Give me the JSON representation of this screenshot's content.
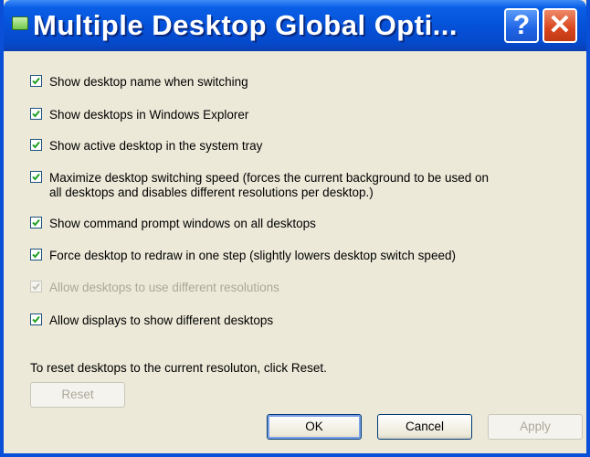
{
  "window": {
    "title": "Multiple Desktop Global Opti...",
    "help_symbol": "?",
    "close_symbol": "✕"
  },
  "options": [
    {
      "label": "Show desktop name when switching",
      "checked": true,
      "enabled": true
    },
    {
      "label": "Show desktops in Windows Explorer",
      "checked": true,
      "enabled": true
    },
    {
      "label": "Show active desktop in the system tray",
      "checked": true,
      "enabled": true
    },
    {
      "label": "Maximize desktop switching speed (forces the current background to be used on\nall desktops and disables different resolutions per desktop.)",
      "checked": true,
      "enabled": true
    },
    {
      "label": "Show command prompt windows on all desktops",
      "checked": true,
      "enabled": true
    },
    {
      "label": "Force desktop to redraw in one step (slightly lowers desktop switch speed)",
      "checked": true,
      "enabled": true
    },
    {
      "label": "Allow desktops to use different resolutions",
      "checked": true,
      "enabled": false
    },
    {
      "label": "Allow displays to show different desktops",
      "checked": true,
      "enabled": true
    }
  ],
  "reset_hint": "To reset desktops to the current resoluton, click Reset.",
  "buttons": {
    "reset": "Reset",
    "ok": "OK",
    "cancel": "Cancel",
    "apply": "Apply"
  }
}
